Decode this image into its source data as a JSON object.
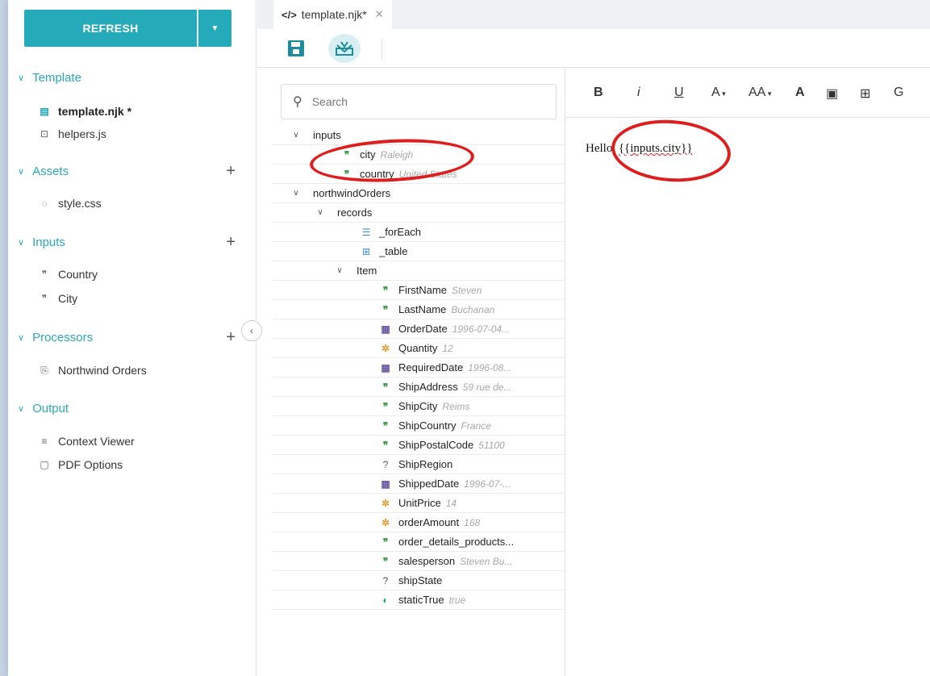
{
  "sidebar": {
    "refresh_label": "REFRESH",
    "sections": [
      {
        "label": "Template",
        "items": [
          {
            "label": "template.njk *",
            "icon": "file-icon",
            "bold": true
          },
          {
            "label": "helpers.js",
            "icon": "script-icon"
          }
        ]
      },
      {
        "label": "Assets",
        "items": [
          {
            "label": "style.css",
            "icon": "stylesheet-icon"
          }
        ]
      },
      {
        "label": "Inputs",
        "items": [
          {
            "label": "Country",
            "icon": "quote-icon"
          },
          {
            "label": "City",
            "icon": "quote-icon"
          }
        ]
      },
      {
        "label": "Processors",
        "items": [
          {
            "label": "Northwind Orders",
            "icon": "processor-icon"
          }
        ]
      },
      {
        "label": "Output",
        "items": [
          {
            "label": "Context Viewer",
            "icon": "list-icon"
          },
          {
            "label": "PDF Options",
            "icon": "pdf-icon"
          }
        ]
      }
    ]
  },
  "tabs": [
    {
      "label": "template.njk*"
    }
  ],
  "search": {
    "placeholder": "Search"
  },
  "tree": [
    {
      "indent": 0,
      "chev": true,
      "label": "inputs",
      "type": "",
      "value": ""
    },
    {
      "indent": 1,
      "chev": false,
      "label": "city",
      "type": "str",
      "value": "Raleigh"
    },
    {
      "indent": 1,
      "chev": false,
      "label": "country",
      "type": "str",
      "value": "United States"
    },
    {
      "indent": 0,
      "chev": true,
      "label": "northwindOrders",
      "type": "",
      "value": ""
    },
    {
      "indent": 1,
      "chev": true,
      "label": "records",
      "type": "",
      "value": ""
    },
    {
      "indent": 2,
      "chev": false,
      "label": "_forEach",
      "type": "list",
      "value": ""
    },
    {
      "indent": 2,
      "chev": false,
      "label": "_table",
      "type": "table",
      "value": ""
    },
    {
      "indent": 2,
      "chev": true,
      "label": "Item",
      "type": "",
      "value": ""
    },
    {
      "indent": 3,
      "chev": false,
      "label": "FirstName",
      "type": "str",
      "value": "Steven"
    },
    {
      "indent": 3,
      "chev": false,
      "label": "LastName",
      "type": "str",
      "value": "Buchanan"
    },
    {
      "indent": 3,
      "chev": false,
      "label": "OrderDate",
      "type": "date",
      "value": "1996-07-04..."
    },
    {
      "indent": 3,
      "chev": false,
      "label": "Quantity",
      "type": "num",
      "value": "12"
    },
    {
      "indent": 3,
      "chev": false,
      "label": "RequiredDate",
      "type": "date",
      "value": "1996-08..."
    },
    {
      "indent": 3,
      "chev": false,
      "label": "ShipAddress",
      "type": "str",
      "value": "59 rue de..."
    },
    {
      "indent": 3,
      "chev": false,
      "label": "ShipCity",
      "type": "str",
      "value": "Reims"
    },
    {
      "indent": 3,
      "chev": false,
      "label": "ShipCountry",
      "type": "str",
      "value": "France"
    },
    {
      "indent": 3,
      "chev": false,
      "label": "ShipPostalCode",
      "type": "str",
      "value": "51100"
    },
    {
      "indent": 3,
      "chev": false,
      "label": "ShipRegion",
      "type": "q",
      "value": ""
    },
    {
      "indent": 3,
      "chev": false,
      "label": "ShippedDate",
      "type": "date",
      "value": "1996-07-..."
    },
    {
      "indent": 3,
      "chev": false,
      "label": "UnitPrice",
      "type": "num",
      "value": "14"
    },
    {
      "indent": 3,
      "chev": false,
      "label": "orderAmount",
      "type": "num",
      "value": "168"
    },
    {
      "indent": 3,
      "chev": false,
      "label": "order_details_products...",
      "type": "str",
      "value": ""
    },
    {
      "indent": 3,
      "chev": false,
      "label": "salesperson",
      "type": "str",
      "value": "Steven Bu..."
    },
    {
      "indent": 3,
      "chev": false,
      "label": "shipState",
      "type": "q",
      "value": ""
    },
    {
      "indent": 3,
      "chev": false,
      "label": "staticTrue",
      "type": "bool",
      "value": "true"
    }
  ],
  "editor": {
    "toolbar": {
      "bold": "B",
      "italic": "i",
      "underline": "U",
      "font_color": "A",
      "font_size": "AA",
      "highlight": "A"
    },
    "text_prefix": "Hello, ",
    "text_expr": "{{inputs.city}}"
  },
  "colors": {
    "accent": "#24aab8",
    "annotation": "#e01d1d"
  }
}
